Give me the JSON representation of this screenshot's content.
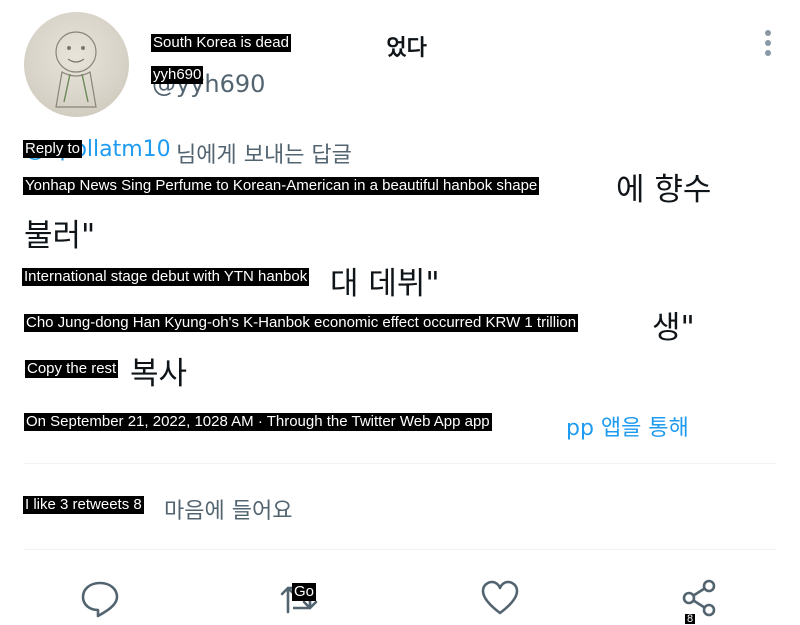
{
  "header": {
    "display_name": "South Korea is dead",
    "name_suffix": "었다",
    "username": "yyh690",
    "handle": "@yyh690"
  },
  "reply_line": {
    "label": "Reply to",
    "ko_tail": "님에게 보내는 답글",
    "mention": "@apollatm10"
  },
  "tweet": {
    "line1": "Yonhap News Sing Perfume to Korean-American in a beautiful hanbok shape",
    "line1_ko_tail": "에 향수",
    "line1_ko_cont": "불러\"",
    "line2": "International stage debut with YTN hanbok",
    "line2_ko_tail": "대 데뷔\"",
    "line3": "Cho Jung-dong Han Kyung-oh's K-Hanbok economic effect occurred KRW 1 trillion",
    "line3_ko_tail": "생\"",
    "line4": "Copy the rest",
    "line4_ko_tail": "복사"
  },
  "meta": {
    "timestamp": "On September 21, 2022, 1028 AM · Through the Twitter Web App app",
    "ko_tail": "pp 앱을 통해"
  },
  "stats": {
    "text": "I like 3 retweets 8",
    "ko_tail": "마음에 들어요"
  },
  "actions": {
    "reply_icon": "reply-icon",
    "retweet_icon": "retweet-icon",
    "retweet_label": "Go",
    "like_icon": "heart-icon",
    "share_icon": "share-icon",
    "share_badge": "8"
  },
  "colors": {
    "text": "#0f1419",
    "secondary": "#536471",
    "link": "#1d9bf0",
    "divider": "#eff3f4",
    "icon": "#536471"
  }
}
